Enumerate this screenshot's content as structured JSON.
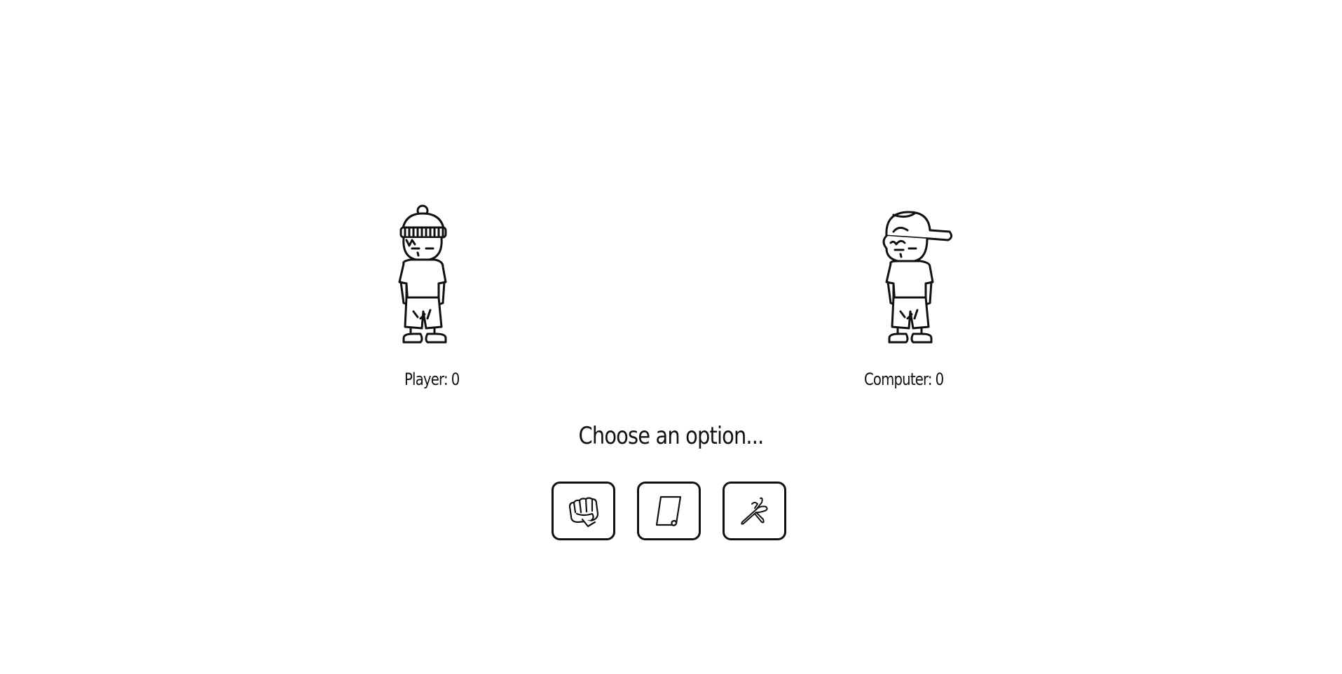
{
  "player": {
    "label": "Player",
    "separator": ":",
    "score": "0",
    "character_icon": "beanie-boy-icon"
  },
  "computer": {
    "label": "Computer",
    "separator": ":",
    "score": "0",
    "character_icon": "cap-boy-icon"
  },
  "prompt": "Choose an option...",
  "options": [
    {
      "name": "rock",
      "icon": "fist-icon"
    },
    {
      "name": "paper",
      "icon": "paper-icon"
    },
    {
      "name": "scissors",
      "icon": "scissors-icon"
    }
  ],
  "colors": {
    "background": "#ffffff",
    "ink": "#111111"
  }
}
